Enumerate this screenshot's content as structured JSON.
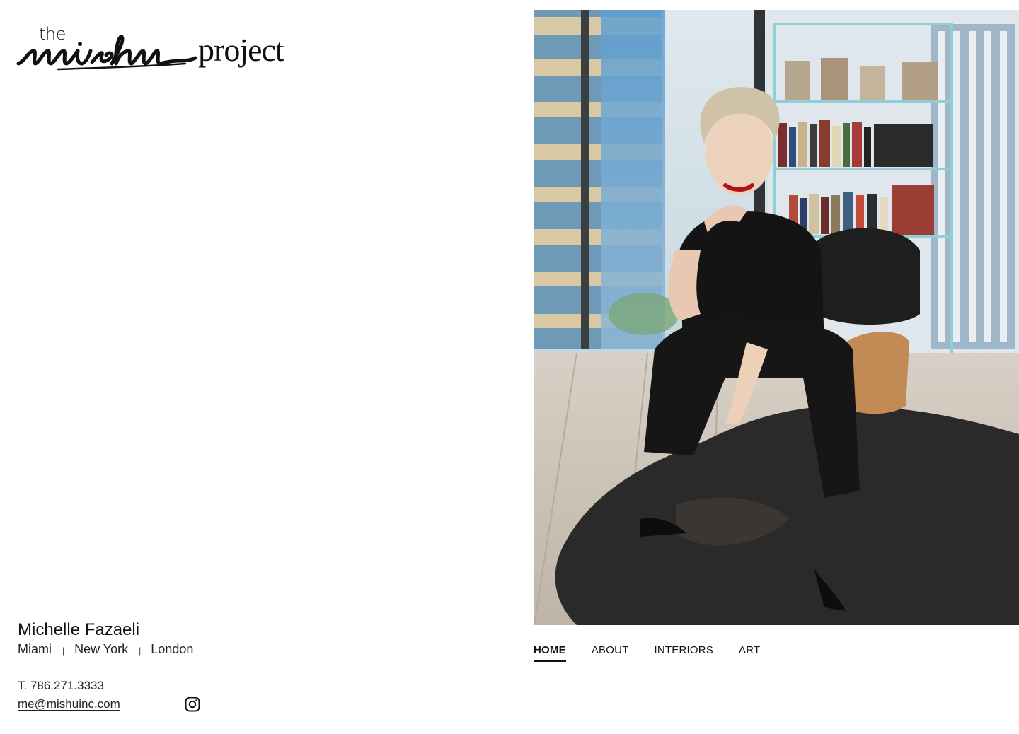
{
  "logo": {
    "the": "the",
    "script_word": "mishu",
    "project": "project"
  },
  "contact": {
    "name": "Michelle Fazaeli",
    "cities": [
      "Miami",
      "New York",
      "London"
    ],
    "separator": "|",
    "phone": "T. 786.271.3333",
    "email": "me@mishuinc.com"
  },
  "nav": {
    "items": [
      {
        "label": "HOME",
        "active": true
      },
      {
        "label": "ABOUT",
        "active": false
      },
      {
        "label": "INTERIORS",
        "active": false
      },
      {
        "label": "ART",
        "active": false
      }
    ]
  },
  "icons": {
    "social": "instagram-icon"
  },
  "colors": {
    "text": "#111111",
    "background": "#ffffff"
  }
}
